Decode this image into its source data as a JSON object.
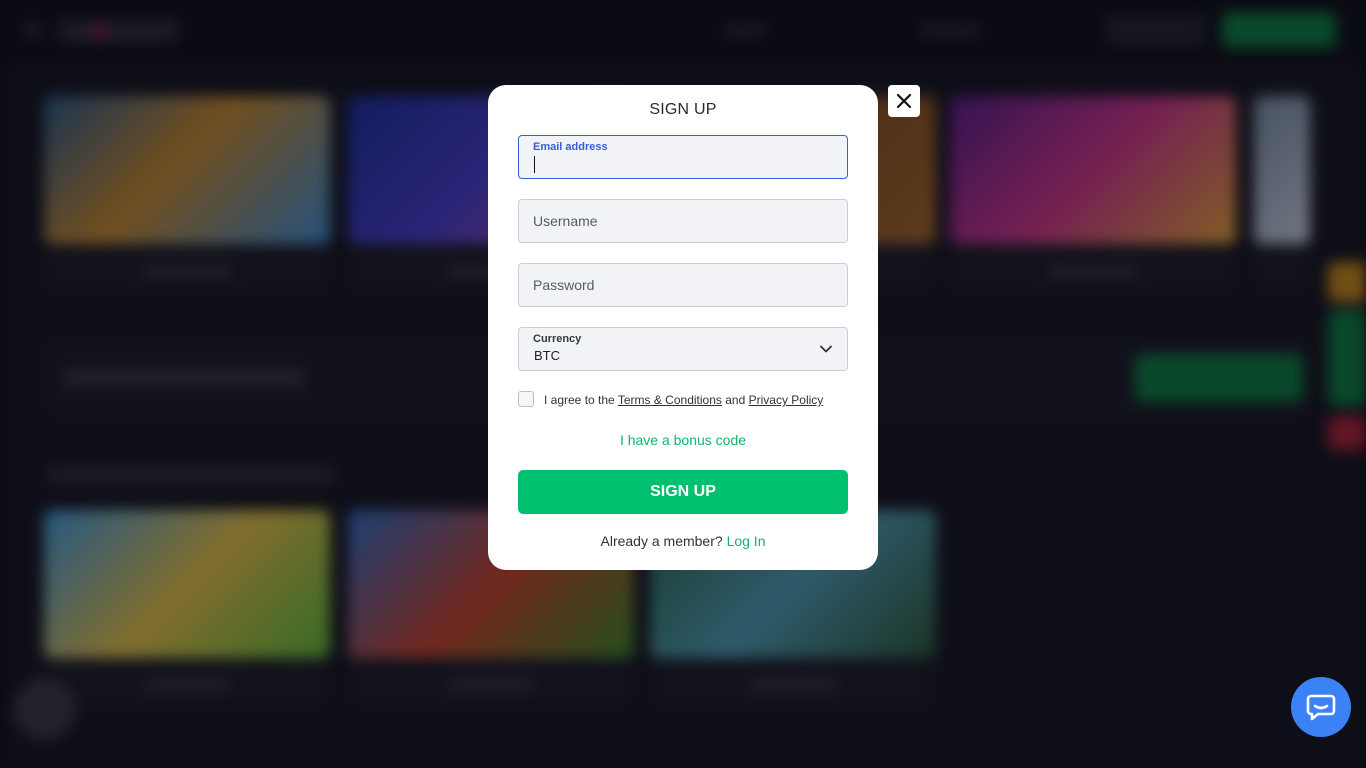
{
  "modal": {
    "title": "SIGN UP",
    "email_label": "Email address",
    "username_placeholder": "Username",
    "password_placeholder": "Password",
    "currency_label": "Currency",
    "currency_value": "BTC",
    "agree_prefix": "I agree to the",
    "terms_link": "Terms & Conditions",
    "agree_and": "and",
    "privacy_link": "Privacy Policy",
    "bonus_link": "I have a bonus code",
    "signup_button": "SIGN UP",
    "member_prompt": "Already a member?",
    "login_link": "Log In"
  },
  "icons": {
    "close": "close-icon",
    "chevron": "chevron-down-icon",
    "chat": "chat-bubble-icon"
  },
  "colors": {
    "accent_green": "#00bf6f",
    "focus_blue": "#3b5bdb",
    "chat_blue": "#3b82f6"
  }
}
